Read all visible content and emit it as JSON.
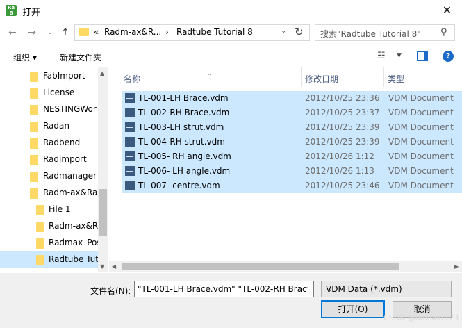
{
  "window": {
    "title": "打开",
    "close_label": "✕",
    "app_icon_top": "Ra",
    "app_icon_bottom": "8"
  },
  "address": {
    "overflow": "«",
    "segments": [
      "Radm-ax&R...",
      "Radtube Tutorial 8"
    ]
  },
  "search": {
    "placeholder": "搜索\"Radtube Tutorial 8\""
  },
  "toolbar": {
    "organize": "组织 ▾",
    "new_folder": "新建文件夹"
  },
  "nav_tree": [
    {
      "label": "FabImport",
      "indent": 0
    },
    {
      "label": "License",
      "indent": 0
    },
    {
      "label": "NESTINGWor",
      "indent": 0
    },
    {
      "label": "Radan",
      "indent": 0
    },
    {
      "label": "Radbend",
      "indent": 0
    },
    {
      "label": "Radimport",
      "indent": 0
    },
    {
      "label": "Radmanager",
      "indent": 0
    },
    {
      "label": "Radm-ax&Ra",
      "indent": 0
    },
    {
      "label": "File 1",
      "indent": 1
    },
    {
      "label": "Radm-ax&R",
      "indent": 1
    },
    {
      "label": "Radmax_Pos",
      "indent": 1
    },
    {
      "label": "Radtube Tut",
      "indent": 1,
      "selected": true
    }
  ],
  "columns": {
    "name": "名称",
    "modified": "修改日期",
    "type": "类型"
  },
  "files": [
    {
      "name": "TL-001-LH Brace.vdm",
      "modified": "2012/10/25 23:36",
      "type": "VDM Document"
    },
    {
      "name": "TL-002-RH Brace.vdm",
      "modified": "2012/10/25 23:37",
      "type": "VDM Document"
    },
    {
      "name": "TL-003-LH strut.vdm",
      "modified": "2012/10/25 23:39",
      "type": "VDM Document"
    },
    {
      "name": "TL-004-RH strut.vdm",
      "modified": "2012/10/25 23:39",
      "type": "VDM Document"
    },
    {
      "name": "TL-005- RH angle.vdm",
      "modified": "2012/10/26 1:12",
      "type": "VDM Document"
    },
    {
      "name": "TL-006- LH angle.vdm",
      "modified": "2012/10/26 1:13",
      "type": "VDM Document"
    },
    {
      "name": "TL-007- centre.vdm",
      "modified": "2012/10/25 23:46",
      "type": "VDM Document"
    }
  ],
  "footer": {
    "filename_label": "文件名(N):",
    "filename_value": "\"TL-001-LH Brace.vdm\" \"TL-002-RH Brac",
    "filetype_value": "VDM Data (*.vdm)",
    "open_button": "打开(O)",
    "cancel_button": "取消"
  },
  "watermark": "CSDN @dddsoft123"
}
